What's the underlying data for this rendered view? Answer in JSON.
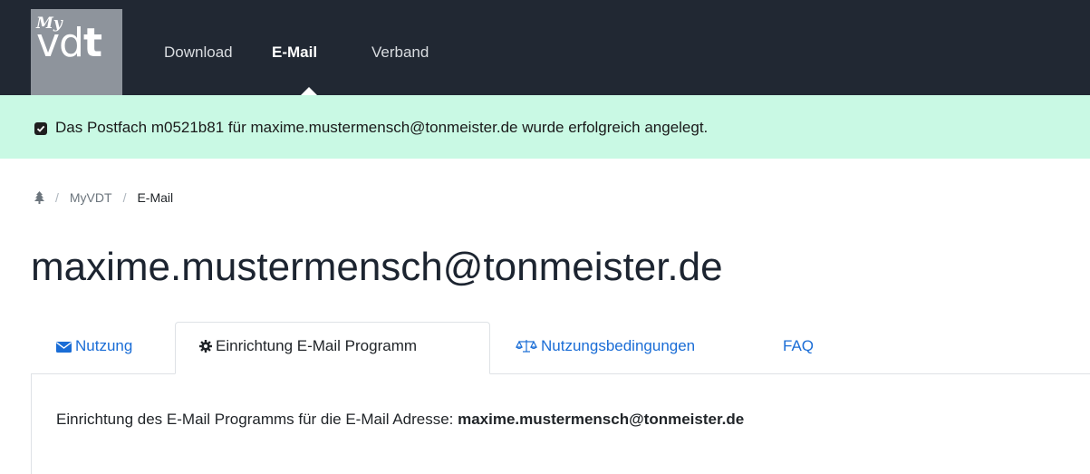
{
  "logo": {
    "my": "My",
    "vd": "vd",
    "t": "t"
  },
  "nav": {
    "items": [
      {
        "label": "Download"
      },
      {
        "label": "E-Mail"
      },
      {
        "label": "Verband"
      }
    ]
  },
  "alert": {
    "text": "Das Postfach m0521b81 für maxime.mustermensch@tonmeister.de wurde erfolgreich angelegt."
  },
  "breadcrumb": {
    "items": [
      "MyVDT",
      "E-Mail"
    ]
  },
  "page": {
    "title": "maxime.mustermensch@tonmeister.de"
  },
  "tabs": [
    {
      "label": "Nutzung",
      "icon": "envelope-icon"
    },
    {
      "label": "Einrichtung E-Mail Programm",
      "icon": "gear-icon"
    },
    {
      "label": "Nutzungsbedingungen",
      "icon": "balance-scale-icon"
    },
    {
      "label": "FAQ"
    }
  ],
  "panel": {
    "text_prefix": "Einrichtung des E-Mail Programms für die E-Mail Adresse: ",
    "email": "maxime.mustermensch@tonmeister.de"
  },
  "colors": {
    "navbar": "#212833",
    "alert": "#c9f9e4",
    "link": "#1a6dd6"
  }
}
